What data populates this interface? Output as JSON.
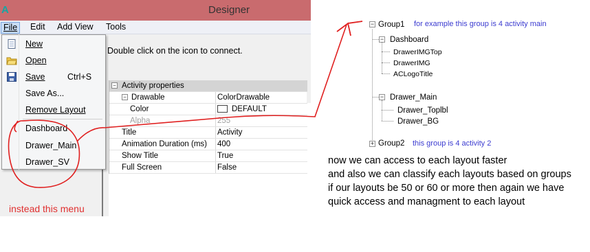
{
  "window": {
    "app_icon": "A",
    "title": "Designer"
  },
  "menubar": [
    "File",
    "Edit",
    "Add View",
    "Tools"
  ],
  "client": {
    "message": "Double click on the icon to connect."
  },
  "file_menu": {
    "items": [
      {
        "label": "New",
        "icon": "new-document-icon",
        "shortcut": ""
      },
      {
        "label": "Open",
        "icon": "open-folder-icon",
        "shortcut": ""
      },
      {
        "label": "Save",
        "icon": "save-disk-icon",
        "shortcut": "Ctrl+S"
      },
      {
        "label": "Save As...",
        "icon": "",
        "shortcut": ""
      },
      {
        "label": "Remove Layout",
        "icon": "",
        "shortcut": ""
      }
    ],
    "layouts": [
      "Dashboard",
      "Drawer_Main",
      "Drawer_SV"
    ]
  },
  "property_grid": {
    "category": "Activity properties",
    "rows": [
      {
        "key": "Drawable",
        "value": "ColorDrawable",
        "indent": 1,
        "expander": "−"
      },
      {
        "key": "Color",
        "value": "DEFAULT",
        "indent": 2,
        "swatch": "#ffffff"
      },
      {
        "key": "Alpha",
        "value": "255",
        "indent": 2,
        "disabled": true
      },
      {
        "key": "Title",
        "value": "Activity",
        "indent": 0
      },
      {
        "key": "Animation Duration (ms)",
        "value": "400",
        "indent": 0
      },
      {
        "key": "Show Title",
        "value": "True",
        "indent": 0
      },
      {
        "key": "Full Screen",
        "value": "False",
        "indent": 0
      }
    ]
  },
  "annotations": {
    "instead_note": "instead this menu",
    "tree": {
      "group1": {
        "label": "Group1",
        "note": "for example this group is 4 activity main"
      },
      "dashboard": {
        "label": "Dashboard",
        "children": [
          "DrawerIMGTop",
          "DrawerIMG",
          "ACLogoTitle"
        ]
      },
      "drawer_main": {
        "label": "Drawer_Main",
        "children": [
          "Drawer_Toplbl",
          "Drawer_BG"
        ]
      },
      "group2": {
        "label": "Group2",
        "note": "this group is 4 activity 2"
      }
    },
    "explanation": [
      "now we can access to each layout faster",
      "and also we can classify each layouts based on groups",
      "if our layouts be 50 or 60 or more then again we have quick access and managment to each layout"
    ],
    "colors": {
      "pen": "#e02020",
      "note_blue": "#3b3bd0",
      "titlebar": "#c96b6e"
    }
  }
}
